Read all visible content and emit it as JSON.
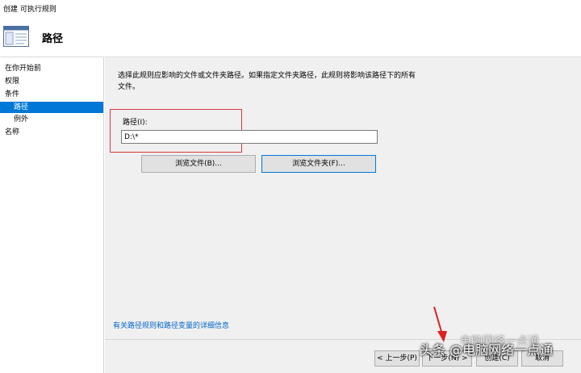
{
  "window": {
    "title": "创建 可执行规则"
  },
  "header": {
    "title": "路径",
    "icon": "rule-page-icon"
  },
  "sidebar": {
    "items": [
      {
        "label": "在你开始前",
        "selected": false,
        "indent": false
      },
      {
        "label": "权限",
        "selected": false,
        "indent": false
      },
      {
        "label": "条件",
        "selected": false,
        "indent": false
      },
      {
        "label": "路径",
        "selected": true,
        "indent": true
      },
      {
        "label": "例外",
        "selected": false,
        "indent": true
      },
      {
        "label": "名称",
        "selected": false,
        "indent": false
      }
    ]
  },
  "main": {
    "description": "选择此规则应影响的文件或文件夹路径。如果指定文件夹路径，此规则将影响该路径下的所有文件。",
    "path_label": "路径(I):",
    "path_value": "D:\\*",
    "browse_files_label": "浏览文件(B)...",
    "browse_folders_label": "浏览文件夹(F)...",
    "help_link": "有关路径规则和路径变量的详细信息"
  },
  "footer": {
    "back_label": "< 上一步(P)",
    "next_label": "下一步(N) >",
    "create_label": "创建(C)",
    "cancel_label": "取消"
  },
  "overlay": {
    "watermark": "头条 @电脑网络一点通",
    "watermark_bg": "电脑网络一点通"
  },
  "colors": {
    "accent": "#0078d7",
    "highlight_border": "#d9363e",
    "link": "#0066cc"
  }
}
